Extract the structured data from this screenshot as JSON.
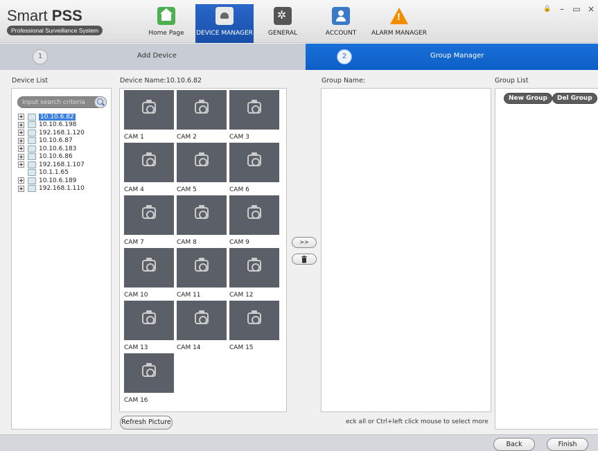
{
  "brand": {
    "name_regular": "Smart ",
    "name_bold": "PSS",
    "subtitle": "Professional Surveillance System"
  },
  "nav": [
    {
      "label": "Home Page",
      "icon": "home-icon"
    },
    {
      "label": "DEVICE MANAGER",
      "icon": "device-manager-icon",
      "active": true
    },
    {
      "label": "GENERAL",
      "icon": "settings-gears-icon"
    },
    {
      "label": "ACCOUNT",
      "icon": "account-icon"
    },
    {
      "label": "ALARM MANAGER",
      "icon": "alarm-warning-icon"
    }
  ],
  "window_controls": {
    "lock": "🔒",
    "minimize": "–",
    "maximize": "▭",
    "close": "×"
  },
  "steps": [
    {
      "number": "1",
      "label": "Add Device"
    },
    {
      "number": "2",
      "label": "Group Manager",
      "active": true
    }
  ],
  "device_list": {
    "title": "Device List",
    "search_placeholder": "Input search criteria",
    "devices": [
      {
        "name": "10.10.6.82",
        "expandable": true,
        "selected": true
      },
      {
        "name": "10.10.6.198",
        "expandable": true
      },
      {
        "name": "192.168.1.120",
        "expandable": true
      },
      {
        "name": "10.10.6.87",
        "expandable": true
      },
      {
        "name": "10.10.6.183",
        "expandable": true
      },
      {
        "name": "10.10.6.86",
        "expandable": true
      },
      {
        "name": "192.168.1.107",
        "expandable": true
      },
      {
        "name": "10.1.1.65",
        "expandable": false
      },
      {
        "name": "10.10.6.189",
        "expandable": true
      },
      {
        "name": "192.168.1.110",
        "expandable": true
      }
    ]
  },
  "channels": {
    "title": "Device Name:10.10.6.82",
    "cameras": [
      "CAM 1",
      "CAM 2",
      "CAM 3",
      "CAM 4",
      "CAM 5",
      "CAM 6",
      "CAM 7",
      "CAM 8",
      "CAM 9",
      "CAM 10",
      "CAM 11",
      "CAM 12",
      "CAM 13",
      "CAM 14",
      "CAM 15",
      "CAM 16"
    ],
    "refresh_label": "Refresh Picture"
  },
  "transfer": {
    "add_label": ">>",
    "delete_icon": "trash-icon"
  },
  "group": {
    "name_title": "Group Name:",
    "list_title": "Group List",
    "new_group_label": "New Group",
    "del_group_label": "Del Group",
    "hint": "eck all or Ctrl+left click mouse to select more"
  },
  "footer": {
    "back_label": "Back",
    "finish_label": "Finish"
  },
  "colors": {
    "accent": "#1a6fd8",
    "thumbnail_bg": "#5a5f68"
  }
}
